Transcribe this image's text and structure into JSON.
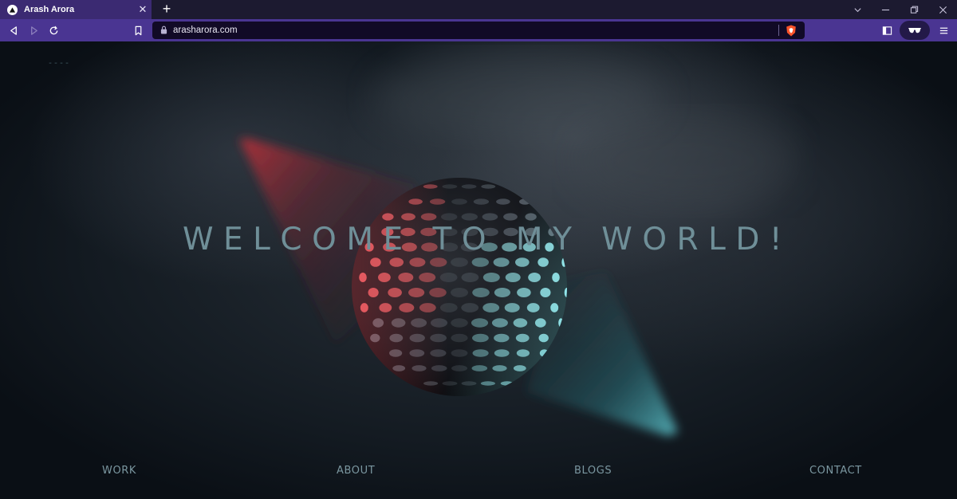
{
  "browser": {
    "tab": {
      "title": "Arash Arora",
      "favicon": "triangle-logo-icon",
      "close_icon": "close-icon"
    },
    "new_tab_icon": "plus-icon",
    "window_controls": [
      "chevron-down-icon",
      "minimize-icon",
      "restore-icon",
      "close-icon"
    ],
    "toolbar": {
      "back_icon": "back-icon",
      "forward_icon": "forward-icon",
      "reload_icon": "reload-icon",
      "bookmark_icon": "bookmark-icon",
      "url": "arasharora.com",
      "lock_icon": "lock-icon",
      "shield_icon": "brave-shield-icon",
      "sidebar_icon": "sidebar-icon",
      "wallet_icon": "wallet-glasses-icon",
      "menu_icon": "hamburger-menu-icon"
    },
    "colors": {
      "tabstrip": "#1c1a30",
      "active_tab": "#3b2a72",
      "toolbar": "#4a3592",
      "omnibox": "#110a26"
    }
  },
  "page": {
    "loader": "----",
    "headline": "WELCOME TO MY WORLD!",
    "nav": [
      {
        "label": "WORK"
      },
      {
        "label": "ABOUT"
      },
      {
        "label": "BLOGS"
      },
      {
        "label": "CONTACT"
      }
    ],
    "colors": {
      "text": "#6f8f98",
      "nav_text": "#7b97a0",
      "red_beam": "#c1303a",
      "teal_beam": "#3fa6b0"
    }
  }
}
